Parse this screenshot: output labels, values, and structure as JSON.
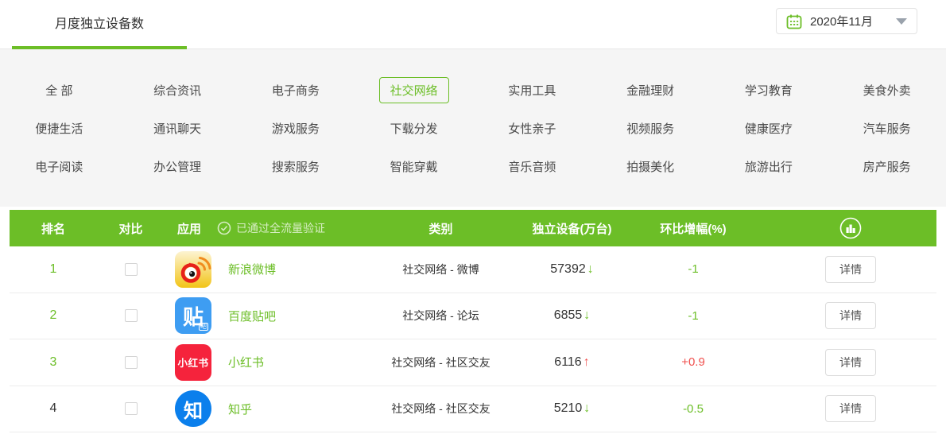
{
  "colors": {
    "accent_green": "#6cbe27",
    "up_red": "#f0504e",
    "panel_gray": "#f5f5f5"
  },
  "header": {
    "tab_label": "月度独立设备数",
    "date_value": "2020年11月",
    "calendar_icon": "calendar-icon",
    "caret_icon": "chevron-down-icon"
  },
  "categories": {
    "selected": "社交网络",
    "items": [
      "全 部",
      "综合资讯",
      "电子商务",
      "社交网络",
      "实用工具",
      "金融理财",
      "学习教育",
      "美食外卖",
      "便捷生活",
      "通讯聊天",
      "游戏服务",
      "下载分发",
      "女性亲子",
      "视频服务",
      "健康医疗",
      "汽车服务",
      "电子阅读",
      "办公管理",
      "搜索服务",
      "智能穿戴",
      "音乐音频",
      "拍摄美化",
      "旅游出行",
      "房产服务"
    ]
  },
  "table": {
    "headers": {
      "rank": "排名",
      "compare": "对比",
      "app": "应用",
      "verified": "已通过全流量验证",
      "category": "类别",
      "devices": "独立设备(万台)",
      "change": "环比增幅(%)"
    },
    "header_icons": {
      "verified": "check-circle-icon",
      "sort": "bar-chart-icon"
    },
    "action_label": "详情",
    "rows": [
      {
        "rank": "1",
        "app": "新浪微博",
        "icon": "weibo-icon",
        "category": "社交网络 - 微博",
        "devices": "57392",
        "trend": "down",
        "trend_arrow": "↓",
        "change": "-1"
      },
      {
        "rank": "2",
        "app": "百度贴吧",
        "icon": "tieba-icon",
        "icon_text": "贴",
        "icon_sub": "吧",
        "category": "社交网络 - 论坛",
        "devices": "6855",
        "trend": "down",
        "trend_arrow": "↓",
        "change": "-1"
      },
      {
        "rank": "3",
        "app": "小红书",
        "icon": "xiaohongshu-icon",
        "icon_text": "小红书",
        "category": "社交网络 - 社区交友",
        "devices": "6116",
        "trend": "up",
        "trend_arrow": "↑",
        "change": "+0.9"
      },
      {
        "rank": "4",
        "app": "知乎",
        "icon": "zhihu-icon",
        "icon_text": "知",
        "category": "社交网络 - 社区交友",
        "devices": "5210",
        "trend": "down",
        "trend_arrow": "↓",
        "change": "-0.5"
      }
    ]
  }
}
